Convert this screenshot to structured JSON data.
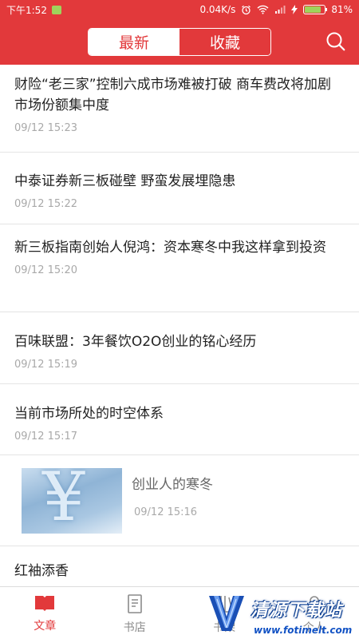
{
  "status_bar": {
    "time": "下午1:52",
    "speed": "0.04K/s",
    "battery": "81%",
    "battery_level": 0.81
  },
  "header": {
    "tabs": [
      "最新",
      "收藏"
    ],
    "active_tab": "最新"
  },
  "articles": [
    {
      "title": "财险“老三家”控制六成市场难被打破 商车费改将加剧市场份额集中度",
      "time": "09/12 15:23"
    },
    {
      "title": "中泰证券新三板碰壁 野蛮发展埋隐患",
      "time": "09/12 15:22"
    },
    {
      "title": "新三板指南创始人倪鸿：资本寒冬中我这样拿到投资",
      "time": "09/12 15:20"
    },
    {
      "title": "百味联盟：3年餐饮O2O创业的铭心经历",
      "time": "09/12 15:19"
    },
    {
      "title": "当前市场所处的时空体系",
      "time": "09/12 15:17"
    },
    {
      "title": "创业人的寒冬",
      "time": "09/12 15:16"
    },
    {
      "title": "红袖添香"
    }
  ],
  "bottom_nav": {
    "items": [
      "文章",
      "书店",
      "书架",
      "个人"
    ],
    "active": "文章"
  },
  "watermark": {
    "name": "清源下载站",
    "url": "www.fotimelt.com"
  },
  "colors": {
    "brand_red": "#e2393b",
    "text_dark": "#222222",
    "text_time": "#a9a9a9"
  }
}
